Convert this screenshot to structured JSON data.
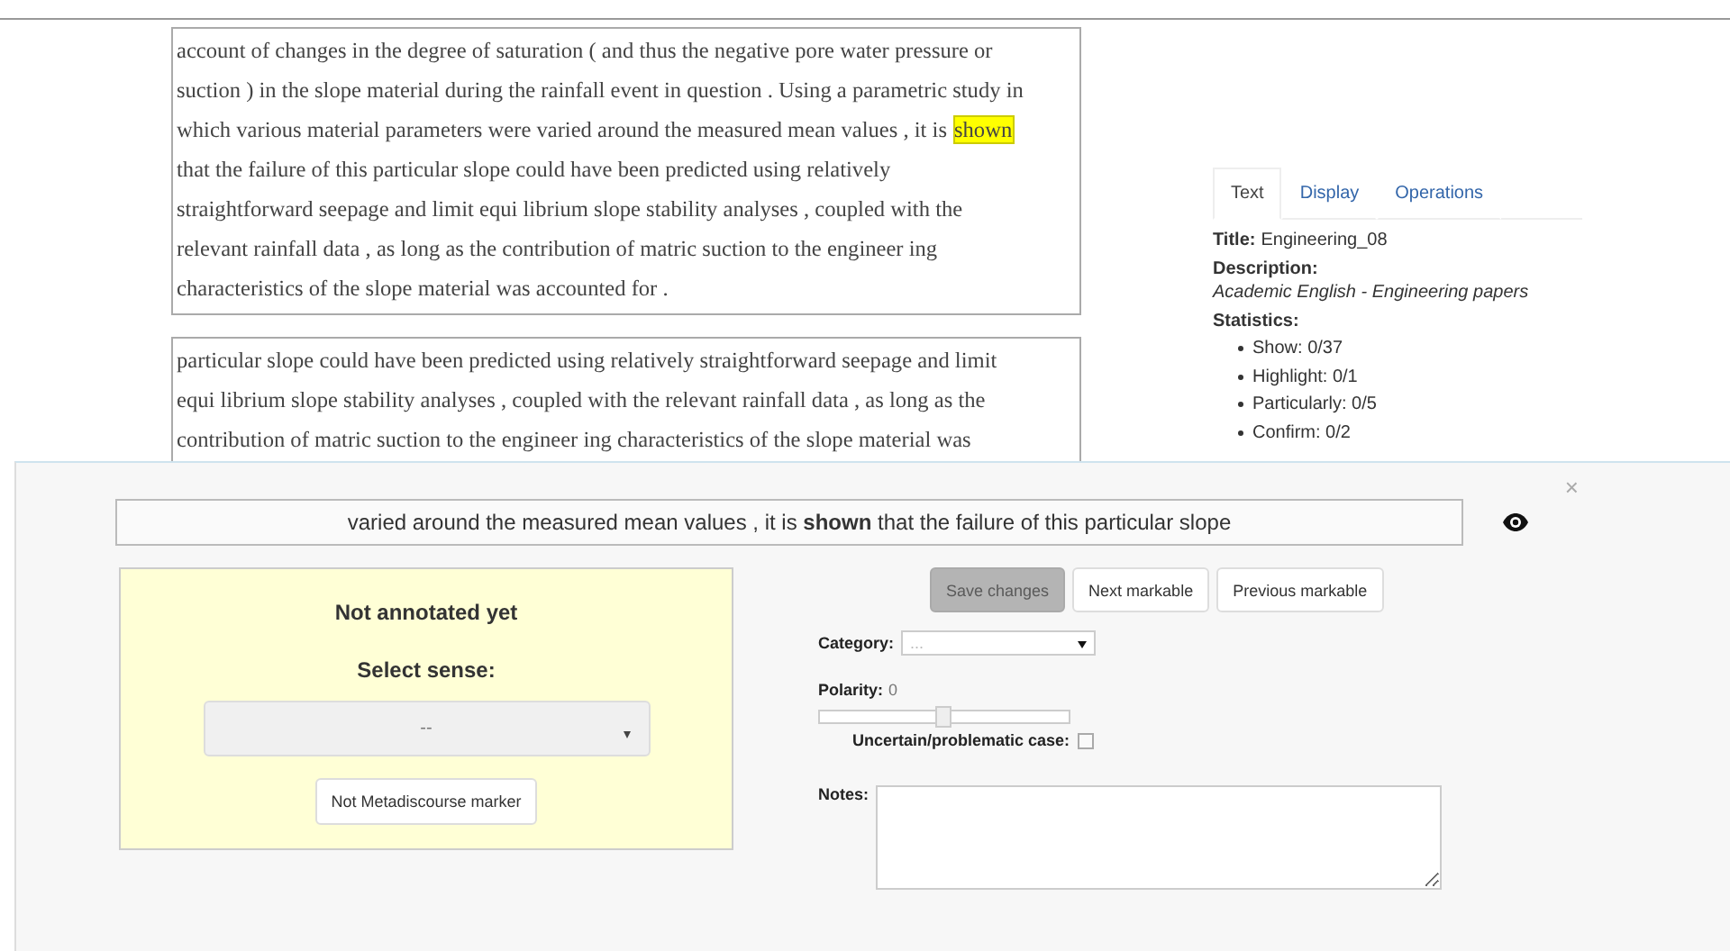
{
  "document": {
    "paragraphs": [
      {
        "lines": [
          [
            {
              "text": "account of changes in the degree of saturation ( and thus the negative pore water pressure or",
              "highlighted": false
            }
          ],
          [
            {
              "text": "suction ) in the slope material during the rainfall event in question . Using a parametric study in",
              "highlighted": false
            }
          ],
          [
            {
              "text": "which various material parameters were varied around the measured mean values , it is",
              "highlighted": false
            },
            {
              "text": "shown",
              "highlighted": true
            }
          ],
          [
            {
              "text": "that the failure of this particular slope could have been predicted using relatively",
              "highlighted": false
            }
          ],
          [
            {
              "text": "straightforward seepage and limit equi librium slope stability analyses , coupled with the",
              "highlighted": false
            }
          ],
          [
            {
              "text": "relevant rainfall data , as long as the contribution of matric suction to the engineer ing",
              "highlighted": false
            }
          ],
          [
            {
              "text": "characteristics of the slope material was accounted for .",
              "highlighted": false
            }
          ]
        ]
      },
      {
        "lines": [
          [
            {
              "text": "particular slope could have been predicted using relatively straightforward seepage and limit",
              "highlighted": false
            }
          ],
          [
            {
              "text": "equi librium slope stability analyses , coupled with the relevant rainfall data , as long as the",
              "highlighted": false
            }
          ],
          [
            {
              "text": "contribution of matric suction to the engineer ing characteristics of the slope material was",
              "highlighted": false
            }
          ]
        ]
      }
    ]
  },
  "sidebar": {
    "tabs": [
      {
        "label": "Text",
        "selected": true
      },
      {
        "label": "Display",
        "selected": false
      },
      {
        "label": "Operations",
        "selected": false
      }
    ],
    "title_label": "Title:",
    "title": "Engineering_08",
    "description_label": "Description:",
    "description": "Academic English - Engineering papers",
    "statistics_label": "Statistics:",
    "statistics": [
      "Show: 0/37",
      "Highlight: 0/1",
      "Particularly: 0/5",
      "Confirm: 0/2"
    ]
  },
  "annotation_panel": {
    "close": "×",
    "sentence": "varied around the measured mean values , it is **shown** that the failure of this particular slope",
    "sense_box": {
      "status": "Not annotated yet",
      "select_label": "Select sense:",
      "select_value": "--",
      "button": "Not Metadiscourse marker"
    },
    "buttons": [
      {
        "label": "Save changes",
        "disabled": true
      },
      {
        "label": "Next markable",
        "disabled": false
      },
      {
        "label": "Previous markable",
        "disabled": false
      }
    ],
    "category_label": "Category:",
    "category_value": "...",
    "polarity_label": "Polarity:",
    "polarity_value": "0",
    "polarity": {
      "level": 0.5
    },
    "uncertain_label": "Uncertain/problematic case:",
    "uncertain": {
      "checked": false
    },
    "notes_label": "Notes:"
  }
}
